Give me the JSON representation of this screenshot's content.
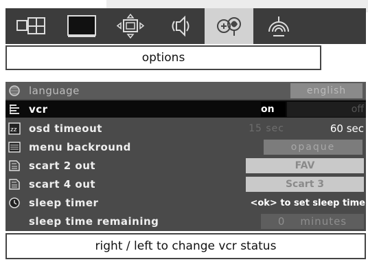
{
  "colors": {
    "panel": "#4a4a4a",
    "selected_row": "#0a0a0a",
    "active_tab": "#d2d2d2"
  },
  "tabs": [
    {
      "name": "picture-in-picture-icon",
      "active": false
    },
    {
      "name": "tv-screen-icon",
      "active": false
    },
    {
      "name": "image-adjust-icon",
      "active": false
    },
    {
      "name": "sound-icon",
      "active": false
    },
    {
      "name": "options-icon",
      "active": true
    },
    {
      "name": "install-antenna-icon",
      "active": false
    }
  ],
  "title": "options",
  "menu": [
    {
      "label": "language",
      "value": "english",
      "style": "gray"
    },
    {
      "label": "vcr",
      "value_on": "on",
      "value_off": "off",
      "style": "selected"
    },
    {
      "label": "osd timeout",
      "value_faded": "15 sec",
      "value": "60 sec",
      "style": "normal"
    },
    {
      "label": "menu backround",
      "value": "opaque",
      "style": "normal"
    },
    {
      "label": "scart 2 out",
      "value": "FAV",
      "style": "normal"
    },
    {
      "label": "scart 4 out",
      "value": "Scart 3",
      "style": "normal"
    },
    {
      "label": "sleep timer",
      "value": "<ok> to set sleep time",
      "style": "normal"
    },
    {
      "label": "sleep time remaining",
      "value_num": "0",
      "value_unit": "minutes",
      "style": "normal"
    }
  ],
  "footer": "right / left to change vcr status"
}
